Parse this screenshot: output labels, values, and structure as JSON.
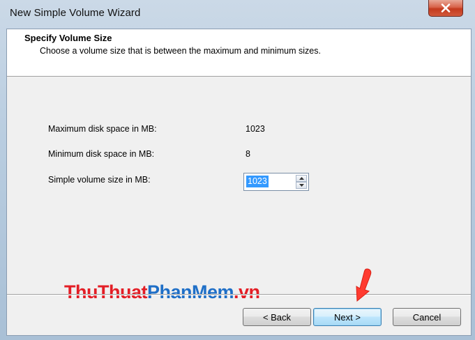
{
  "window": {
    "title": "New Simple Volume Wizard"
  },
  "header": {
    "title": "Specify Volume Size",
    "subtitle": "Choose a volume size that is between the maximum and minimum sizes."
  },
  "fields": {
    "max_label": "Maximum disk space in MB:",
    "max_value": "1023",
    "min_label": "Minimum disk space in MB:",
    "min_value": "8",
    "size_label": "Simple volume size in MB:",
    "size_value": "1023"
  },
  "buttons": {
    "back": "< Back",
    "next": "Next >",
    "cancel": "Cancel"
  },
  "watermark": {
    "part1": "ThuThuat",
    "part2": "PhanMem",
    "part3": ".vn"
  },
  "icons": {
    "close": "close-icon",
    "spin_up": "chevron-up-icon",
    "spin_down": "chevron-down-icon",
    "annotation": "red-arrow-icon"
  },
  "colors": {
    "selection": "#3399ff",
    "watermark_red": "#e31e26",
    "watermark_blue": "#1f6fc7",
    "close_button": "#c43a1e"
  }
}
